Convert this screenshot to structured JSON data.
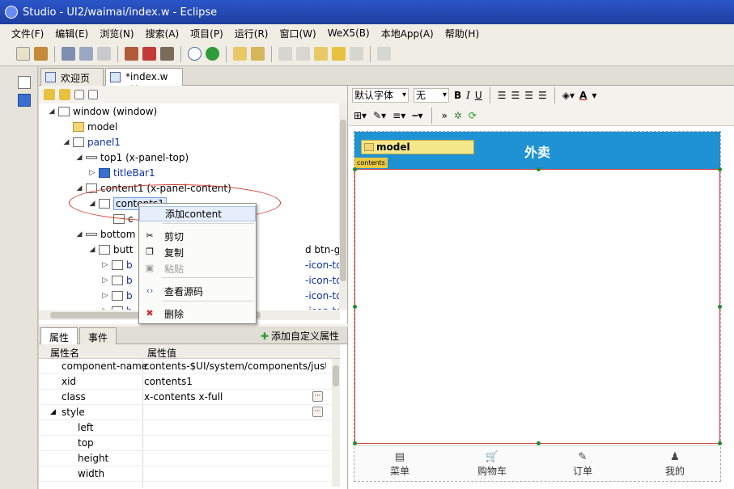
{
  "window": {
    "title": "Studio - UI2/waimai/index.w - Eclipse"
  },
  "menu": [
    "文件(F)",
    "编辑(E)",
    "浏览(N)",
    "搜索(A)",
    "项目(P)",
    "运行(R)",
    "窗口(W)",
    "WeX5(B)",
    "本地App(A)",
    "帮助(H)"
  ],
  "editor_tabs": [
    {
      "label": "欢迎页"
    },
    {
      "label": "*index.w",
      "close": "✕"
    }
  ],
  "tree": [
    {
      "label": "window (window)",
      "twisty": "◢",
      "icon": "window-icon",
      "blue": false
    },
    {
      "label": "model",
      "twisty": "",
      "icon": "folder-icon",
      "blue": false
    },
    {
      "label": "panel1",
      "twisty": "◢",
      "icon": "panel-icon",
      "blue": true
    },
    {
      "label": "top1 (x-panel-top)",
      "twisty": "◢",
      "icon": "bar-icon",
      "blue": false
    },
    {
      "label": "titleBar1",
      "twisty": "▷",
      "icon": "titlebar-icon",
      "blue": true
    },
    {
      "label": "content1 (x-panel-content)",
      "twisty": "◢",
      "icon": "box-icon",
      "blue": false
    },
    {
      "label": "contents1",
      "twisty": "◢",
      "icon": "contents-icon",
      "blue": false
    },
    {
      "label": "c",
      "twisty": "",
      "icon": "box-icon",
      "blue": false
    },
    {
      "label": "bottom",
      "twisty": "◢",
      "icon": "bar-icon",
      "blue": false
    },
    {
      "label": "butt",
      "twisty": "◢",
      "icon": "group-icon",
      "blue": false,
      "suffix": "d btn-group-justi"
    },
    {
      "label": "b",
      "twisty": "▷",
      "icon": "button-icon",
      "blue": true,
      "suffix": "-icon-top)"
    },
    {
      "label": "b",
      "twisty": "▷",
      "icon": "button-icon",
      "blue": true,
      "suffix": "-icon-top)"
    },
    {
      "label": "b",
      "twisty": "▷",
      "icon": "button-icon",
      "blue": true,
      "suffix": "-icon-top)"
    },
    {
      "label": "b",
      "twisty": "▷",
      "icon": "button-icon",
      "blue": true,
      "suffix": "-icon-top)"
    }
  ],
  "context_menu": [
    {
      "label": "添加content",
      "icon": "",
      "selected": true,
      "disabled": false
    },
    {
      "label": "剪切",
      "icon": "scissors-icon",
      "selected": false,
      "disabled": false
    },
    {
      "label": "复制",
      "icon": "copy-icon",
      "selected": false,
      "disabled": false
    },
    {
      "label": "粘贴",
      "icon": "paste-icon",
      "selected": false,
      "disabled": true
    },
    {
      "label": "查看源码",
      "icon": "code-icon",
      "selected": false,
      "disabled": false
    },
    {
      "label": "删除",
      "icon": "delete-icon",
      "selected": false,
      "disabled": false
    }
  ],
  "properties": {
    "tabs": [
      "属性",
      "事件"
    ],
    "add_label": "添加自定义属性",
    "col_name": "属性名",
    "col_value": "属性值",
    "rows": [
      {
        "name": "component-name",
        "value": "contents-$UI/system/components/justep/",
        "indent": 1,
        "editor": false,
        "twisty": ""
      },
      {
        "name": "xid",
        "value": "contents1",
        "indent": 1,
        "editor": false,
        "twisty": ""
      },
      {
        "name": "class",
        "value": "x-contents x-full",
        "indent": 1,
        "editor": true,
        "twisty": ""
      },
      {
        "name": "style",
        "value": "",
        "indent": 0,
        "editor": true,
        "twisty": "◢"
      },
      {
        "name": "left",
        "value": "",
        "indent": 2,
        "editor": false,
        "twisty": ""
      },
      {
        "name": "top",
        "value": "",
        "indent": 2,
        "editor": false,
        "twisty": ""
      },
      {
        "name": "height",
        "value": "",
        "indent": 2,
        "editor": false,
        "twisty": ""
      },
      {
        "name": "width",
        "value": "",
        "indent": 2,
        "editor": false,
        "twisty": ""
      }
    ]
  },
  "design": {
    "font": "默认字体",
    "size": "无",
    "bold": "B",
    "italic": "I",
    "underline": "U",
    "font_color": "A",
    "title": "外卖",
    "model_label": "model",
    "contents_tag": "contents",
    "tabs": [
      {
        "label": "菜单",
        "icon": "menu-doc-icon",
        "glyph": "▤"
      },
      {
        "label": "购物车",
        "icon": "cart-icon",
        "glyph": "🛒"
      },
      {
        "label": "订单",
        "icon": "edit-icon",
        "glyph": "✎"
      },
      {
        "label": "我的",
        "icon": "user-icon",
        "glyph": "♟"
      }
    ],
    "accent": "#1f92d4"
  }
}
